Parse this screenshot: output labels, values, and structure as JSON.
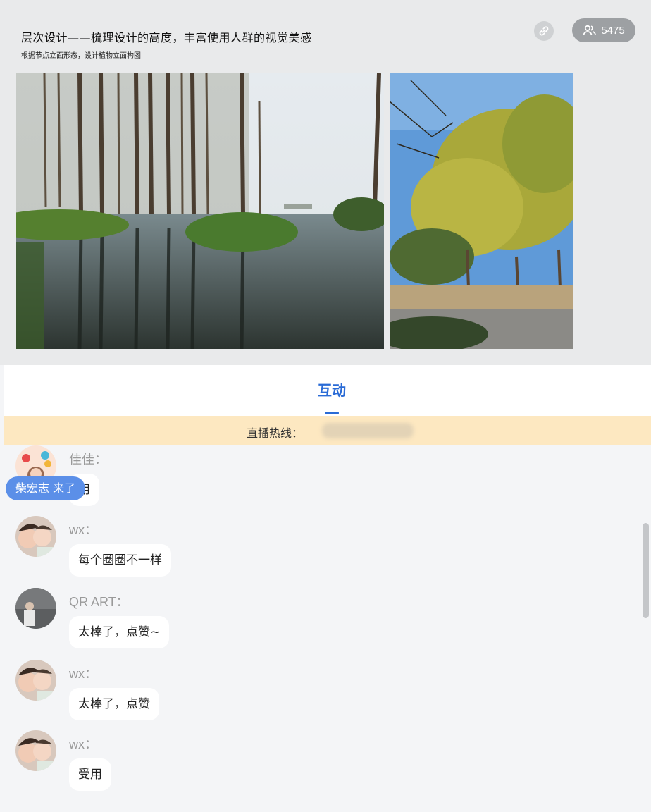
{
  "slide": {
    "title": "层次设计——梳理设计的高度，丰富使用人群的视觉美感",
    "subtitle": "根据节点立面形态，设计植物立面构图"
  },
  "header": {
    "link_icon": "link-icon",
    "viewer_icon": "users-icon",
    "viewer_count": "5475"
  },
  "tabs": [
    {
      "label": "互动",
      "active": true
    }
  ],
  "hotline": {
    "label": "直播热线："
  },
  "join_toast": "柴宏志  来了",
  "messages": [
    {
      "nick": "佳佳：",
      "text": "用",
      "avatar": "balloon-girl"
    },
    {
      "nick": "wx：",
      "text": "每个圈圈不一样",
      "avatar": "mother-child"
    },
    {
      "nick": "QR ART：",
      "text": "太棒了，点赞~",
      "avatar": "person-gray"
    },
    {
      "nick": "wx：",
      "text": "太棒了，点赞",
      "avatar": "mother-child"
    },
    {
      "nick": "wx：",
      "text": "受用",
      "avatar": "mother-child"
    }
  ],
  "colors": {
    "accent": "#2a6bd6",
    "hotline_bg": "#fde8c1",
    "toast_bg": "#5b8fe8"
  }
}
